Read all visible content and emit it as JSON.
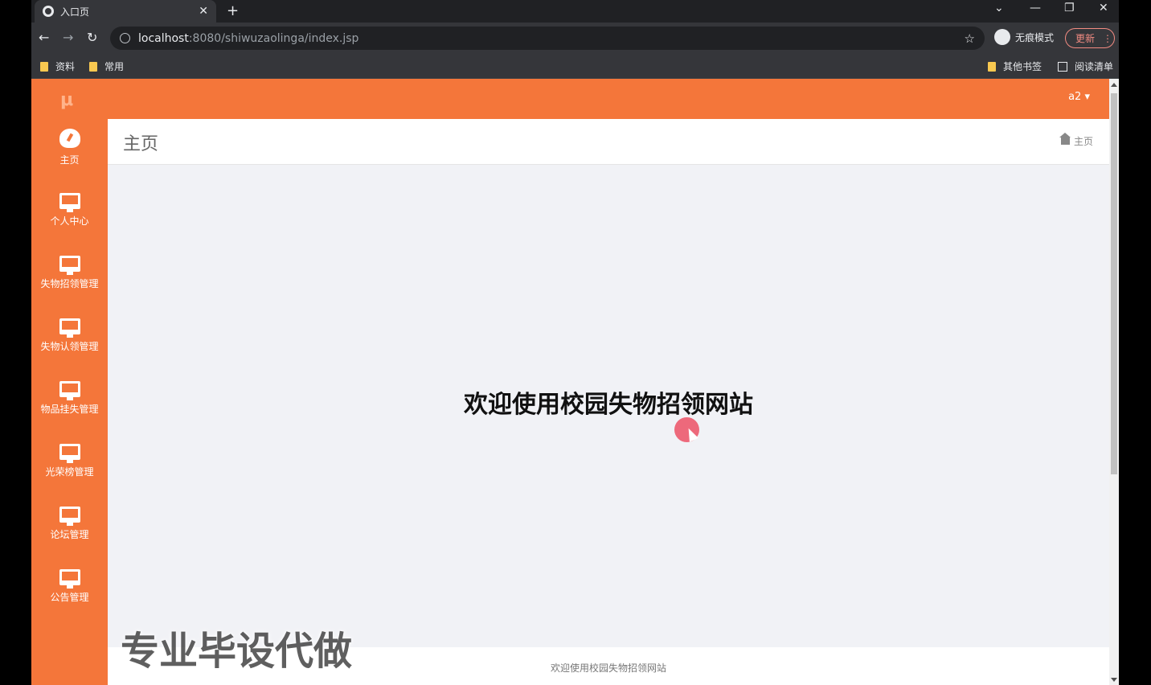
{
  "browser": {
    "tab_title": "入口页",
    "tab_close": "✕",
    "new_tab": "+",
    "url_host": "localhost",
    "url_path": ":8080/shiwuzaolinga/index.jsp",
    "incognito_label": "无痕模式",
    "update_label": "更新",
    "bookmarks": [
      "资料",
      "常用"
    ],
    "other_bookmarks": "其他书签",
    "reading_list": "阅读清单",
    "icons": [
      "back-arrow",
      "forward-arrow",
      "reload",
      "info",
      "star",
      "chevron-down",
      "minimize",
      "restore",
      "close"
    ]
  },
  "app": {
    "logo": "μ",
    "user": "a2 ▾",
    "sidebar": [
      {
        "label": "主页",
        "icon": "dashboard-icon"
      },
      {
        "label": "个人中心",
        "icon": "monitor-icon"
      },
      {
        "label": "失物招领管理",
        "icon": "monitor-icon"
      },
      {
        "label": "失物认领管理",
        "icon": "monitor-icon"
      },
      {
        "label": "物品挂失管理",
        "icon": "monitor-icon"
      },
      {
        "label": "光荣榜管理",
        "icon": "monitor-icon"
      },
      {
        "label": "论坛管理",
        "icon": "monitor-icon"
      },
      {
        "label": "公告管理",
        "icon": "monitor-icon"
      }
    ],
    "page_title": "主页",
    "breadcrumb": "主页",
    "welcome": "欢迎使用校园失物招领网站",
    "footer": "欢迎使用校园失物招领网站",
    "accent_color": "#f4763a"
  },
  "overlay": {
    "watermark": "专业毕设代做"
  }
}
